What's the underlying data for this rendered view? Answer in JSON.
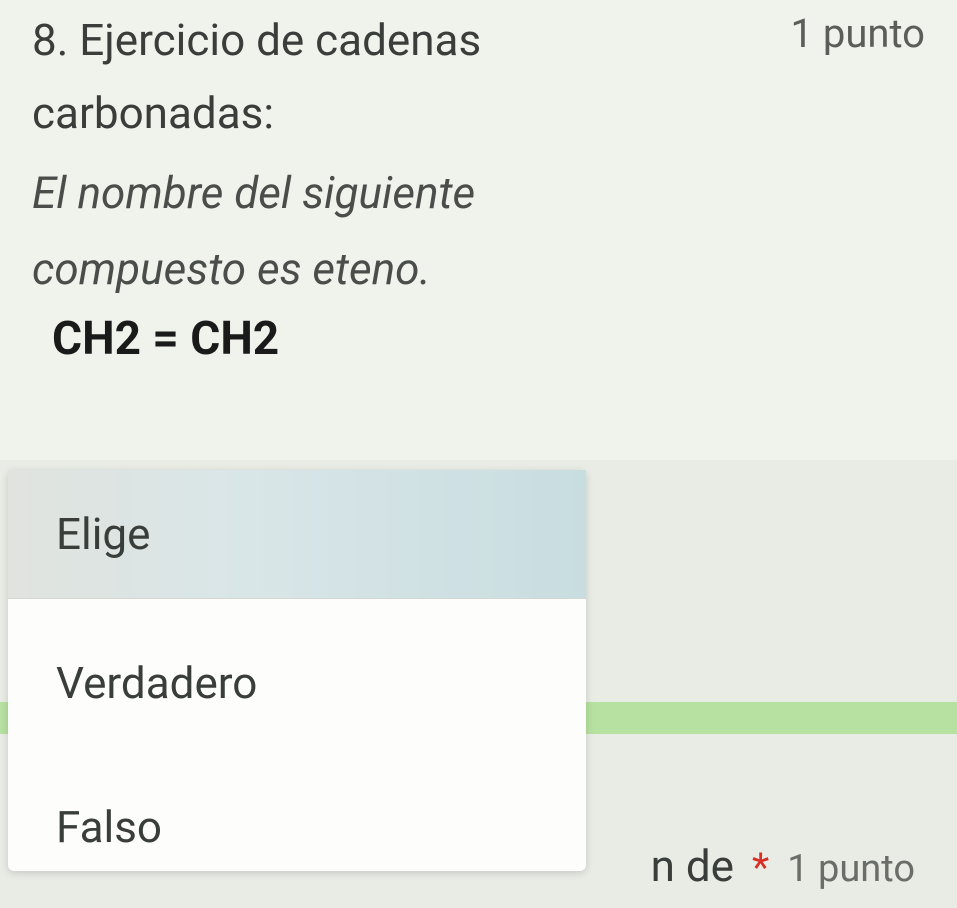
{
  "question": {
    "number_title": "8. Ejercicio de cadenas",
    "subtitle": "carbonadas:",
    "statement_line1": "El nombre del siguiente",
    "statement_line2": "compuesto es eteno.",
    "formula": "CH2 = CH2",
    "points": "1 punto"
  },
  "dropdown": {
    "placeholder": "Elige",
    "options": {
      "true": "Verdadero",
      "false": "Falso"
    }
  },
  "next_question": {
    "partial_text": "n de",
    "required": "*",
    "points": "1 punto"
  }
}
